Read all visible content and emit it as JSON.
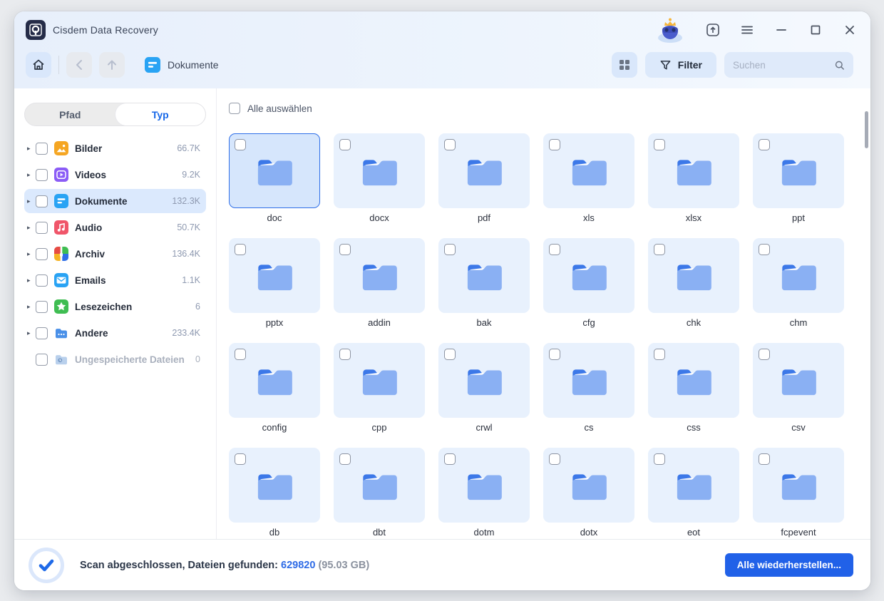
{
  "window": {
    "title": "Cisdem Data Recovery"
  },
  "titlebar": {
    "icons": [
      "mascot-icon",
      "upgrade-icon",
      "menu-icon",
      "minimize-icon",
      "maximize-icon",
      "close-icon"
    ]
  },
  "toolbar": {
    "breadcrumb": "Dokumente",
    "filter_label": "Filter",
    "search_placeholder": "Suchen"
  },
  "sidebar": {
    "tabs": [
      {
        "label": "Pfad",
        "active": false
      },
      {
        "label": "Typ",
        "active": true
      }
    ],
    "items": [
      {
        "label": "Bilder",
        "count": "66.7K",
        "icon": "image-icon",
        "color": "#f5a623",
        "selected": false,
        "disabled": false,
        "expandable": true
      },
      {
        "label": "Videos",
        "count": "9.2K",
        "icon": "video-icon",
        "color": "#8b5cf6",
        "selected": false,
        "disabled": false,
        "expandable": true
      },
      {
        "label": "Dokumente",
        "count": "132.3K",
        "icon": "document-icon",
        "color": "#29a3f4",
        "selected": true,
        "disabled": false,
        "expandable": true
      },
      {
        "label": "Audio",
        "count": "50.7K",
        "icon": "audio-icon",
        "color": "#f0566a",
        "selected": false,
        "disabled": false,
        "expandable": true
      },
      {
        "label": "Archiv",
        "count": "136.4K",
        "icon": "archive-icon",
        "color": "multi",
        "selected": false,
        "disabled": false,
        "expandable": true
      },
      {
        "label": "Emails",
        "count": "1.1K",
        "icon": "email-icon",
        "color": "#29a3f4",
        "selected": false,
        "disabled": false,
        "expandable": true
      },
      {
        "label": "Lesezeichen",
        "count": "6",
        "icon": "bookmark-icon",
        "color": "#3fbd52",
        "selected": false,
        "disabled": false,
        "expandable": true
      },
      {
        "label": "Andere",
        "count": "233.4K",
        "icon": "folder-other-icon",
        "color": "#4a90e8",
        "selected": false,
        "disabled": false,
        "expandable": true
      },
      {
        "label": "Ungespeicherte Dateien",
        "count": "0",
        "icon": "unsaved-files-icon",
        "color": "#b9d0ec",
        "selected": false,
        "disabled": true,
        "expandable": false
      }
    ]
  },
  "main": {
    "select_all_label": "Alle auswählen",
    "folders": [
      {
        "label": "doc",
        "selected": true
      },
      {
        "label": "docx",
        "selected": false
      },
      {
        "label": "pdf",
        "selected": false
      },
      {
        "label": "xls",
        "selected": false
      },
      {
        "label": "xlsx",
        "selected": false
      },
      {
        "label": "ppt",
        "selected": false
      },
      {
        "label": "pptx",
        "selected": false
      },
      {
        "label": "addin",
        "selected": false
      },
      {
        "label": "bak",
        "selected": false
      },
      {
        "label": "cfg",
        "selected": false
      },
      {
        "label": "chk",
        "selected": false
      },
      {
        "label": "chm",
        "selected": false
      },
      {
        "label": "config",
        "selected": false
      },
      {
        "label": "cpp",
        "selected": false
      },
      {
        "label": "crwl",
        "selected": false
      },
      {
        "label": "cs",
        "selected": false
      },
      {
        "label": "css",
        "selected": false
      },
      {
        "label": "csv",
        "selected": false
      },
      {
        "label": "db",
        "selected": false
      },
      {
        "label": "dbt",
        "selected": false
      },
      {
        "label": "dotm",
        "selected": false
      },
      {
        "label": "dotx",
        "selected": false
      },
      {
        "label": "eot",
        "selected": false
      },
      {
        "label": "fcpevent",
        "selected": false
      }
    ]
  },
  "statusbar": {
    "status_text": "Scan abgeschlossen, Dateien gefunden:",
    "files_found": "629820",
    "size_text": "(95.03 GB)",
    "recover_button": "Alle wiederherstellen..."
  },
  "colors": {
    "accent": "#2161e8",
    "folder_back": "#3c78e8",
    "folder_front": "#8ab0f3",
    "tile_bg": "#e8f1fd",
    "tile_selected_bg": "#d6e6fc",
    "topbar_bg": "#e7effb"
  }
}
